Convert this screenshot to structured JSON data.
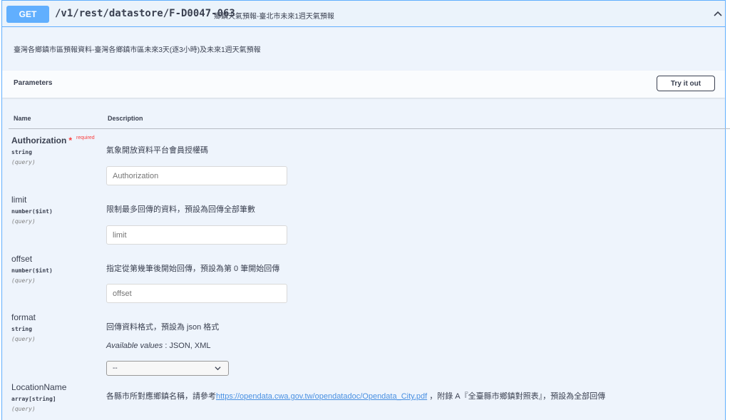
{
  "endpoint": {
    "method": "GET",
    "path": "/v1/rest/datastore/F-D0047-063",
    "summary": "鄉鎮天氣預報-臺北市未來1週天氣預報",
    "description": "臺灣各鄉鎮市區預報資料-臺灣各鄉鎮市區未來3天(逐3小時)及未來1週天氣預報"
  },
  "parameters_section": {
    "title": "Parameters",
    "try_button": "Try it out",
    "col_name": "Name",
    "col_description": "Description"
  },
  "params": [
    {
      "name": "Authorization",
      "required_mark": "*",
      "required_label": "required",
      "type": "string",
      "in": "(query)",
      "description": "氣象開放資料平台會員授權碼",
      "placeholder": "Authorization"
    },
    {
      "name": "limit",
      "type": "number($int)",
      "in": "(query)",
      "description": "限制最多回傳的資料，預設為回傳全部筆數",
      "placeholder": "limit"
    },
    {
      "name": "offset",
      "type": "number($int)",
      "in": "(query)",
      "description": "指定從第幾筆後開始回傳，預設為第 0 筆開始回傳",
      "placeholder": "offset"
    },
    {
      "name": "format",
      "type": "string",
      "in": "(query)",
      "description": "回傳資料格式，預設為 json 格式",
      "available_label": "Available values",
      "available_values": " : JSON, XML",
      "selected": "--"
    },
    {
      "name": "LocationName",
      "type": "array[string]",
      "in": "(query)",
      "description_prefix": "各縣市所對應鄉鎮名稱，請參考",
      "link": "https://opendata.cwa.gov.tw/opendatadoc/Opendata_City.pdf",
      "description_suffix": " ，附錄 A『全臺縣市鄉鎮對照表』，預設為全部回傳"
    }
  ],
  "colors": {
    "get_blue": "#61affe",
    "required_red": "#f93e3e",
    "text": "#3b4151",
    "link": "#4990e2"
  },
  "icons": {
    "collapse": "chevron-up-icon",
    "select_caret": "chevron-down-icon"
  }
}
